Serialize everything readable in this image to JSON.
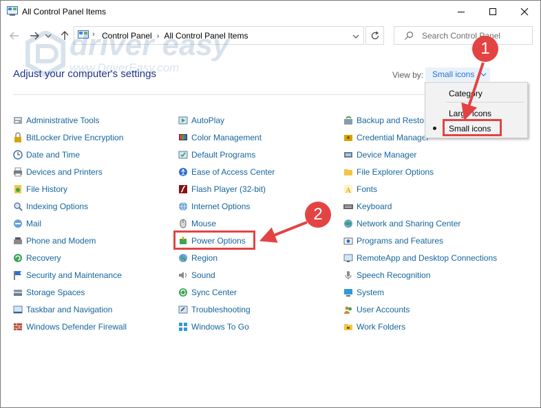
{
  "window": {
    "title": "All Control Panel Items",
    "minimize": "—",
    "maximize": "☐",
    "close": "✕"
  },
  "address": {
    "crumbs": [
      "Control Panel",
      "All Control Panel Items"
    ],
    "search_placeholder": "Search Control Panel"
  },
  "header": {
    "heading": "Adjust your computer's settings",
    "view_by_label": "View by:",
    "view_by_value": "Small icons"
  },
  "dropdown": {
    "options": [
      "Category",
      "Large icons",
      "Small icons"
    ],
    "selected": "Small icons"
  },
  "items": {
    "col1": [
      {
        "label": "Administrative Tools",
        "icon": "admin-tools"
      },
      {
        "label": "BitLocker Drive Encryption",
        "icon": "bitlocker"
      },
      {
        "label": "Date and Time",
        "icon": "clock"
      },
      {
        "label": "Devices and Printers",
        "icon": "printer"
      },
      {
        "label": "File History",
        "icon": "file-history"
      },
      {
        "label": "Indexing Options",
        "icon": "indexing"
      },
      {
        "label": "Mail",
        "icon": "mail"
      },
      {
        "label": "Phone and Modem",
        "icon": "phone"
      },
      {
        "label": "Recovery",
        "icon": "recovery"
      },
      {
        "label": "Security and Maintenance",
        "icon": "flag"
      },
      {
        "label": "Storage Spaces",
        "icon": "storage"
      },
      {
        "label": "Taskbar and Navigation",
        "icon": "taskbar"
      },
      {
        "label": "Windows Defender Firewall",
        "icon": "firewall"
      }
    ],
    "col2": [
      {
        "label": "AutoPlay",
        "icon": "autoplay"
      },
      {
        "label": "Color Management",
        "icon": "color"
      },
      {
        "label": "Default Programs",
        "icon": "default-programs"
      },
      {
        "label": "Ease of Access Center",
        "icon": "ease-access"
      },
      {
        "label": "Flash Player (32-bit)",
        "icon": "flash"
      },
      {
        "label": "Internet Options",
        "icon": "internet"
      },
      {
        "label": "Mouse",
        "icon": "mouse"
      },
      {
        "label": "Power Options",
        "icon": "power"
      },
      {
        "label": "Region",
        "icon": "region"
      },
      {
        "label": "Sound",
        "icon": "sound"
      },
      {
        "label": "Sync Center",
        "icon": "sync"
      },
      {
        "label": "Troubleshooting",
        "icon": "troubleshooting"
      },
      {
        "label": "Windows To Go",
        "icon": "windows-to-go"
      }
    ],
    "col3": [
      {
        "label": "Backup and Restore",
        "icon": "backup"
      },
      {
        "label": "Credential Manager",
        "icon": "credential"
      },
      {
        "label": "Device Manager",
        "icon": "device-manager"
      },
      {
        "label": "File Explorer Options",
        "icon": "folder"
      },
      {
        "label": "Fonts",
        "icon": "fonts"
      },
      {
        "label": "Keyboard",
        "icon": "keyboard"
      },
      {
        "label": "Network and Sharing Center",
        "icon": "network"
      },
      {
        "label": "Programs and Features",
        "icon": "programs"
      },
      {
        "label": "RemoteApp and Desktop Connections",
        "icon": "remoteapp"
      },
      {
        "label": "Speech Recognition",
        "icon": "speech"
      },
      {
        "label": "System",
        "icon": "system"
      },
      {
        "label": "User Accounts",
        "icon": "users"
      },
      {
        "label": "Work Folders",
        "icon": "work-folders"
      }
    ]
  },
  "annotations": {
    "step1": "1",
    "step2": "2"
  },
  "watermark": {
    "brand": "driver easy",
    "url": "www.DriverEasy.com"
  },
  "colors": {
    "link": "#16659b",
    "heading": "#1e3287",
    "accent": "#2f6fd1",
    "annotation": "#e34343"
  }
}
